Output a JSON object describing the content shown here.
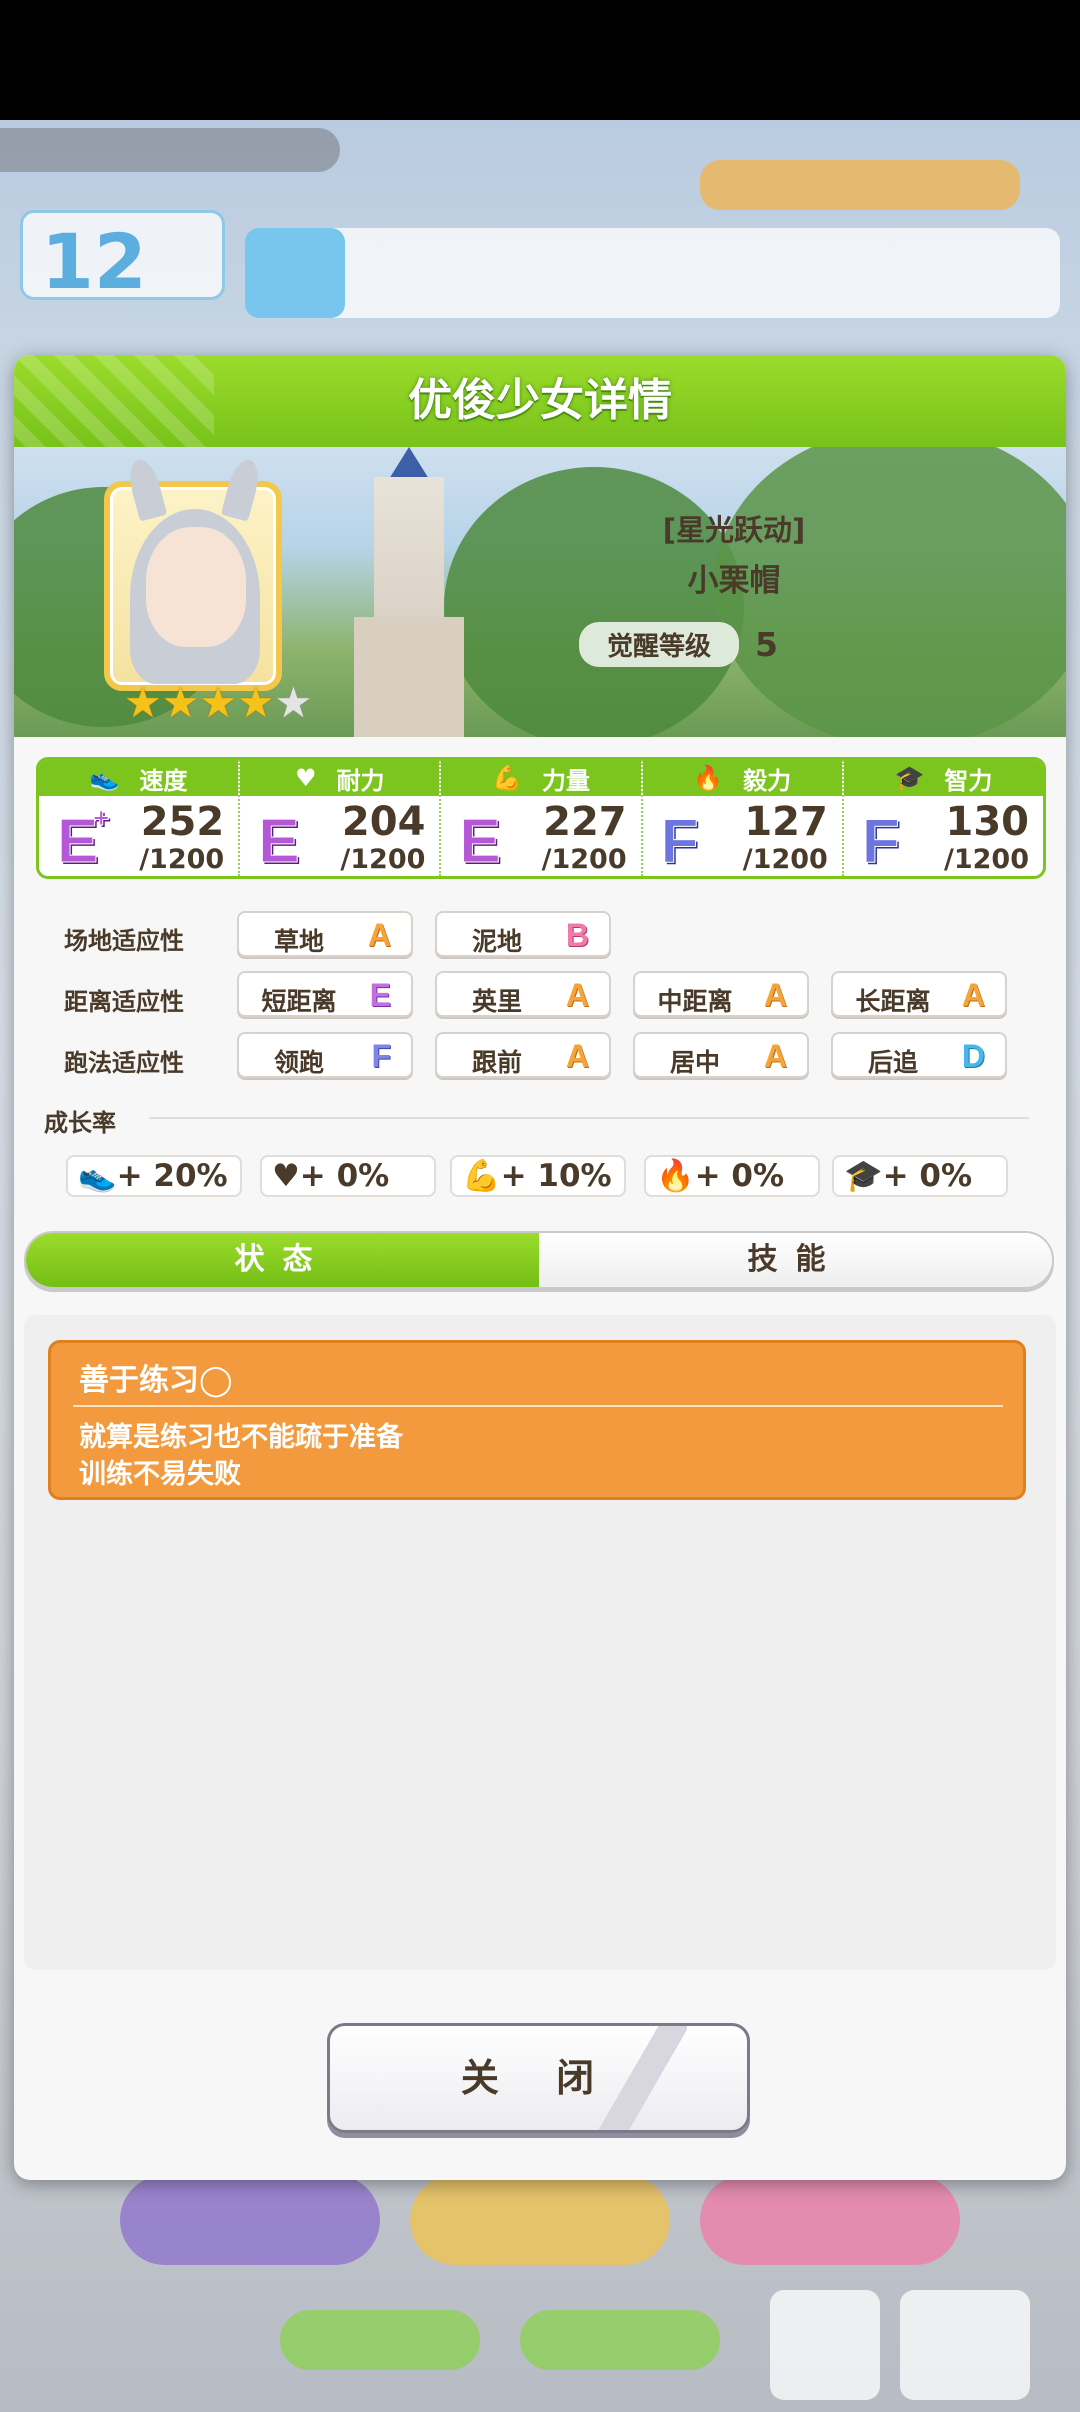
{
  "dialog": {
    "title": "优俊少女详情",
    "close_label": "关 闭"
  },
  "character": {
    "epithet": "[星光跃动]",
    "name": "小栗帽",
    "awaken_label": "觉醒等级",
    "awaken_level": "5",
    "stars_filled": 4,
    "stars_total": 5
  },
  "stats": [
    {
      "label": "速度",
      "icon": "shoe-icon",
      "grade": "E",
      "plus": "+",
      "value": "252",
      "max": "/1200"
    },
    {
      "label": "耐力",
      "icon": "heart-icon",
      "grade": "E",
      "plus": "",
      "value": "204",
      "max": "/1200"
    },
    {
      "label": "力量",
      "icon": "muscle-icon",
      "grade": "E",
      "plus": "",
      "value": "227",
      "max": "/1200"
    },
    {
      "label": "毅力",
      "icon": "fire-icon",
      "grade": "F",
      "plus": "",
      "value": "127",
      "max": "/1200"
    },
    {
      "label": "智力",
      "icon": "graduation-cap-icon",
      "grade": "F",
      "plus": "",
      "value": "130",
      "max": "/1200"
    }
  ],
  "aptitude": {
    "track_label": "场地适应性",
    "distance_label": "距离适应性",
    "strategy_label": "跑法适应性",
    "track": [
      {
        "name": "草地",
        "grade": "A"
      },
      {
        "name": "泥地",
        "grade": "B"
      }
    ],
    "distance": [
      {
        "name": "短距离",
        "grade": "E"
      },
      {
        "name": "英里",
        "grade": "A"
      },
      {
        "name": "中距离",
        "grade": "A"
      },
      {
        "name": "长距离",
        "grade": "A"
      }
    ],
    "strategy": [
      {
        "name": "领跑",
        "grade": "F"
      },
      {
        "name": "跟前",
        "grade": "A"
      },
      {
        "name": "居中",
        "grade": "A"
      },
      {
        "name": "后追",
        "grade": "D"
      }
    ]
  },
  "growth": {
    "label": "成长率",
    "items": [
      {
        "icon": "shoe-icon",
        "value": "+ 20%"
      },
      {
        "icon": "heart-icon",
        "value": "+ 0%"
      },
      {
        "icon": "muscle-icon",
        "value": "+ 10%"
      },
      {
        "icon": "fire-icon",
        "value": "+ 0%"
      },
      {
        "icon": "graduation-cap-icon",
        "value": "+ 0%"
      }
    ]
  },
  "tabs": [
    {
      "label": "状态",
      "active": true
    },
    {
      "label": "技能",
      "active": false
    }
  ],
  "conditions": [
    {
      "name": "善于练习◯",
      "desc_line1": "就算是练习也不能疏于准备",
      "desc_line2": "训练不易失败"
    }
  ],
  "background_hud": {
    "turn_number": "12"
  },
  "colors": {
    "accent_green": "#7cc41e",
    "condition_orange": "#f39a3e"
  }
}
